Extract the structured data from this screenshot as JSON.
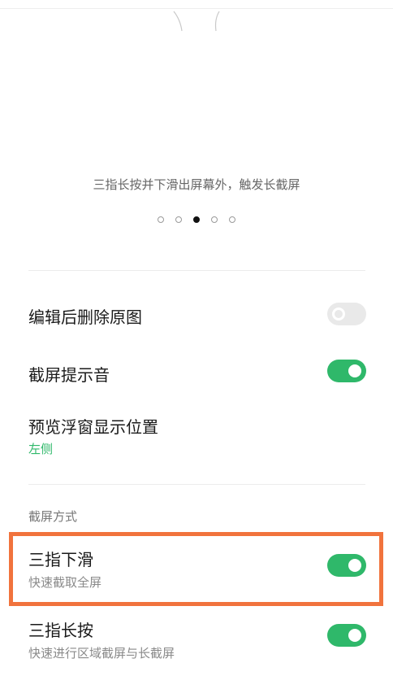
{
  "caption": "三指长按并下滑出屏幕外，触发长截屏",
  "pager": {
    "count": 5,
    "active_index": 2
  },
  "settings": [
    {
      "title": "编辑后删除原图",
      "enabled": false
    },
    {
      "title": "截屏提示音",
      "enabled": true
    },
    {
      "title": "预览浮窗显示位置",
      "value": "左侧"
    }
  ],
  "section_header": "截屏方式",
  "methods": [
    {
      "title": "三指下滑",
      "subtitle": "快速截取全屏",
      "enabled": true,
      "highlighted": true
    },
    {
      "title": "三指长按",
      "subtitle": "快速进行区域截屏与长截屏",
      "enabled": true
    }
  ],
  "colors": {
    "accent_green": "#2fb86a",
    "highlight_orange": "#f1733d"
  }
}
